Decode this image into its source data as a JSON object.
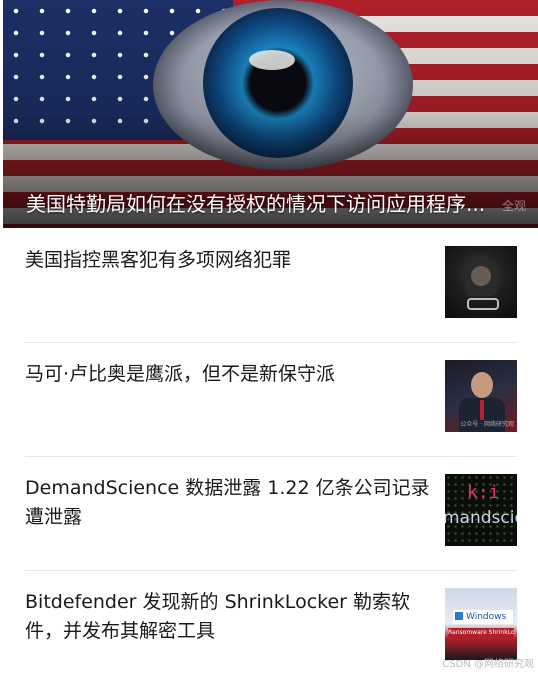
{
  "hero": {
    "caption": "美国特勤局如何在没有授权的情况下访问应用程序...",
    "watermark": "全观"
  },
  "articles": [
    {
      "title": "美国指控黑客犯有多项网络犯罪"
    },
    {
      "title": "马可·卢比奥是鹰派，但不是新保守派",
      "thumb_watermark": "公众号 · 网络研究观"
    },
    {
      "title": "DemandScience 数据泄露 1.22 亿条公司记录遭泄露",
      "thumb_logo": "k:i",
      "thumb_word": "mandscie"
    },
    {
      "title": "Bitdefender 发现新的 ShrinkLocker 勒索软件，并发布其解密工具",
      "thumb_window_label": "Windows",
      "thumb_band": "Ransomware ShrinkLocker"
    }
  ],
  "footer": {
    "watermark": "CSDN @网络研究观"
  }
}
